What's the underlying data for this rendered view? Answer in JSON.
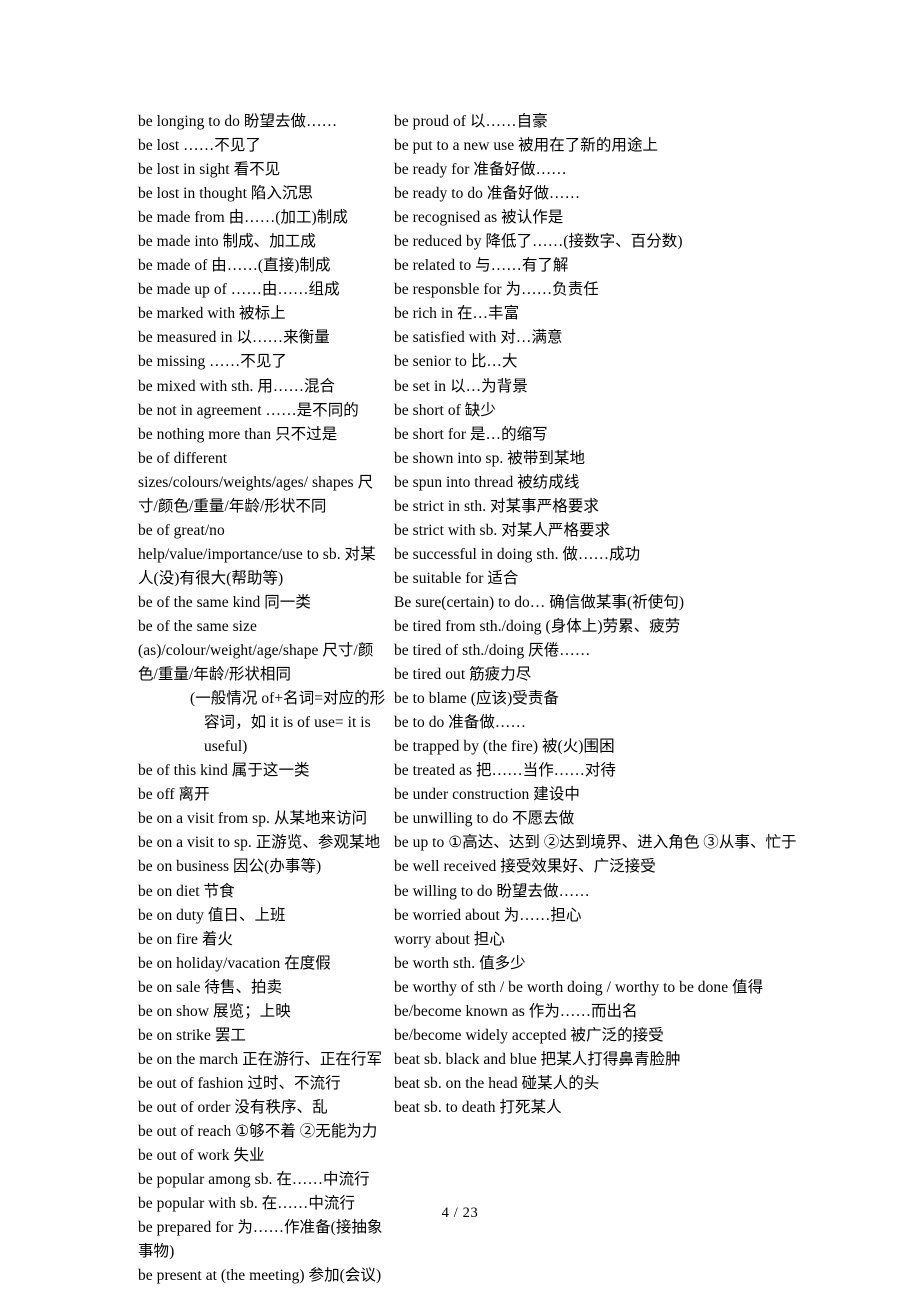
{
  "document": {
    "footer": "4  / 23"
  },
  "left_column": {
    "entries": [
      "be longing to do 盼望去做……",
      "be lost  ……不见了",
      "be lost in sight 看不见",
      "be lost in thought 陷入沉思",
      "be made from  由……(加工)制成",
      "be made into  制成、加工成",
      "be made of  由……(直接)制成",
      "be made up of  ……由……组成",
      "be marked with  被标上",
      "be measured in 以……来衡量",
      "be missing  ……不见了",
      "be mixed with sth.  用……混合",
      "be not in agreement  ……是不同的",
      "be nothing more than  只不过是",
      "be of different sizes/colours/weights/ages/ shapes  尺寸/颜色/重量/年龄/形状不同",
      "be of great/no help/value/importance/use to sb. 对某人(没)有很大(帮助等)",
      "be of the same kind  同一类",
      "be of the same size (as)/colour/weight/age/shape  尺寸/颜色/重量/年龄/形状相同",
      "be of this kind  属于这一类",
      "be off  离开",
      "be on a visit from sp.  从某地来访问",
      "be on a visit to sp.  正游览、参观某地",
      "be on business  因公(办事等)",
      "be on diet  节食",
      "be on duty  值日、上班",
      "be on fire  着火",
      "be on holiday/vacation  在度假",
      "be on sale  待售、拍卖",
      "be on show  展览；上映",
      "be on strike 罢工",
      "be on the march  正在游行、正在行军",
      "be out of fashion  过时、不流行",
      "be out of order  没有秩序、乱",
      "be out of reach  ①够不着  ②无能为力",
      "be out of work  失业",
      "be popular among sb.  在……中流行",
      "be popular with sb.  在……中流行",
      "be prepared for  为……作准备(接抽象事物)",
      "be present at (the meeting)  参加(会议)"
    ],
    "note": {
      "line1": "(一般情况  of+名词=对应的形",
      "line2": "容词，如  it is of use= it is useful)"
    }
  },
  "right_column": {
    "entries": [
      "be proud of  以……自豪",
      "be put to a new use  被用在了新的用途上",
      "be ready for  准备好做……",
      "be ready to do  准备好做……",
      "be recognised as  被认作是",
      "be reduced by  降低了……(接数字、百分数)",
      "be related to  与……有了解",
      "be responsble for  为……负责任",
      "be rich in  在…丰富",
      "be satisfied with 对…满意",
      "be senior to  比…大",
      "be set in  以…为背景",
      "be short of 缺少",
      "be short for  是…的缩写",
      "be shown into sp.  被带到某地",
      "be spun into thread  被纺成线",
      "be strict in sth. 对某事严格要求",
      "be strict with sb. 对某人严格要求",
      "be successful in doing sth.  做……成功",
      "be suitable for  适合",
      "Be sure(certain) to do…  确信做某事(祈使句)",
      "be tired from sth./doing (身体上)劳累、疲劳",
      "be tired of sth./doing 厌倦……",
      "be tired out 筋疲力尽",
      "be to blame (应该)受责备",
      "be to do  准备做……",
      "be trapped by (the fire)  被(火)围困",
      "be treated as  把……当作……对待",
      "be under construction  建设中",
      "be unwilling to do  不愿去做",
      "be up to  ①高达、达到  ②达到境界、进入角色  ③从事、忙于",
      "be well received  接受效果好、广泛接受",
      "be willing to do 盼望去做……",
      "be worried about 为……担心",
      "worry about  担心",
      "be worth sth.  值多少",
      "be worthy of sth / be worth doing / worthy to be done 值得",
      "be/become known as  作为……而出名",
      "be/become widely accepted  被广泛的接受",
      "beat sb. black and blue  把某人打得鼻青脸肿",
      "beat sb. on the head  碰某人的头",
      "beat sb. to death  打死某人"
    ]
  }
}
